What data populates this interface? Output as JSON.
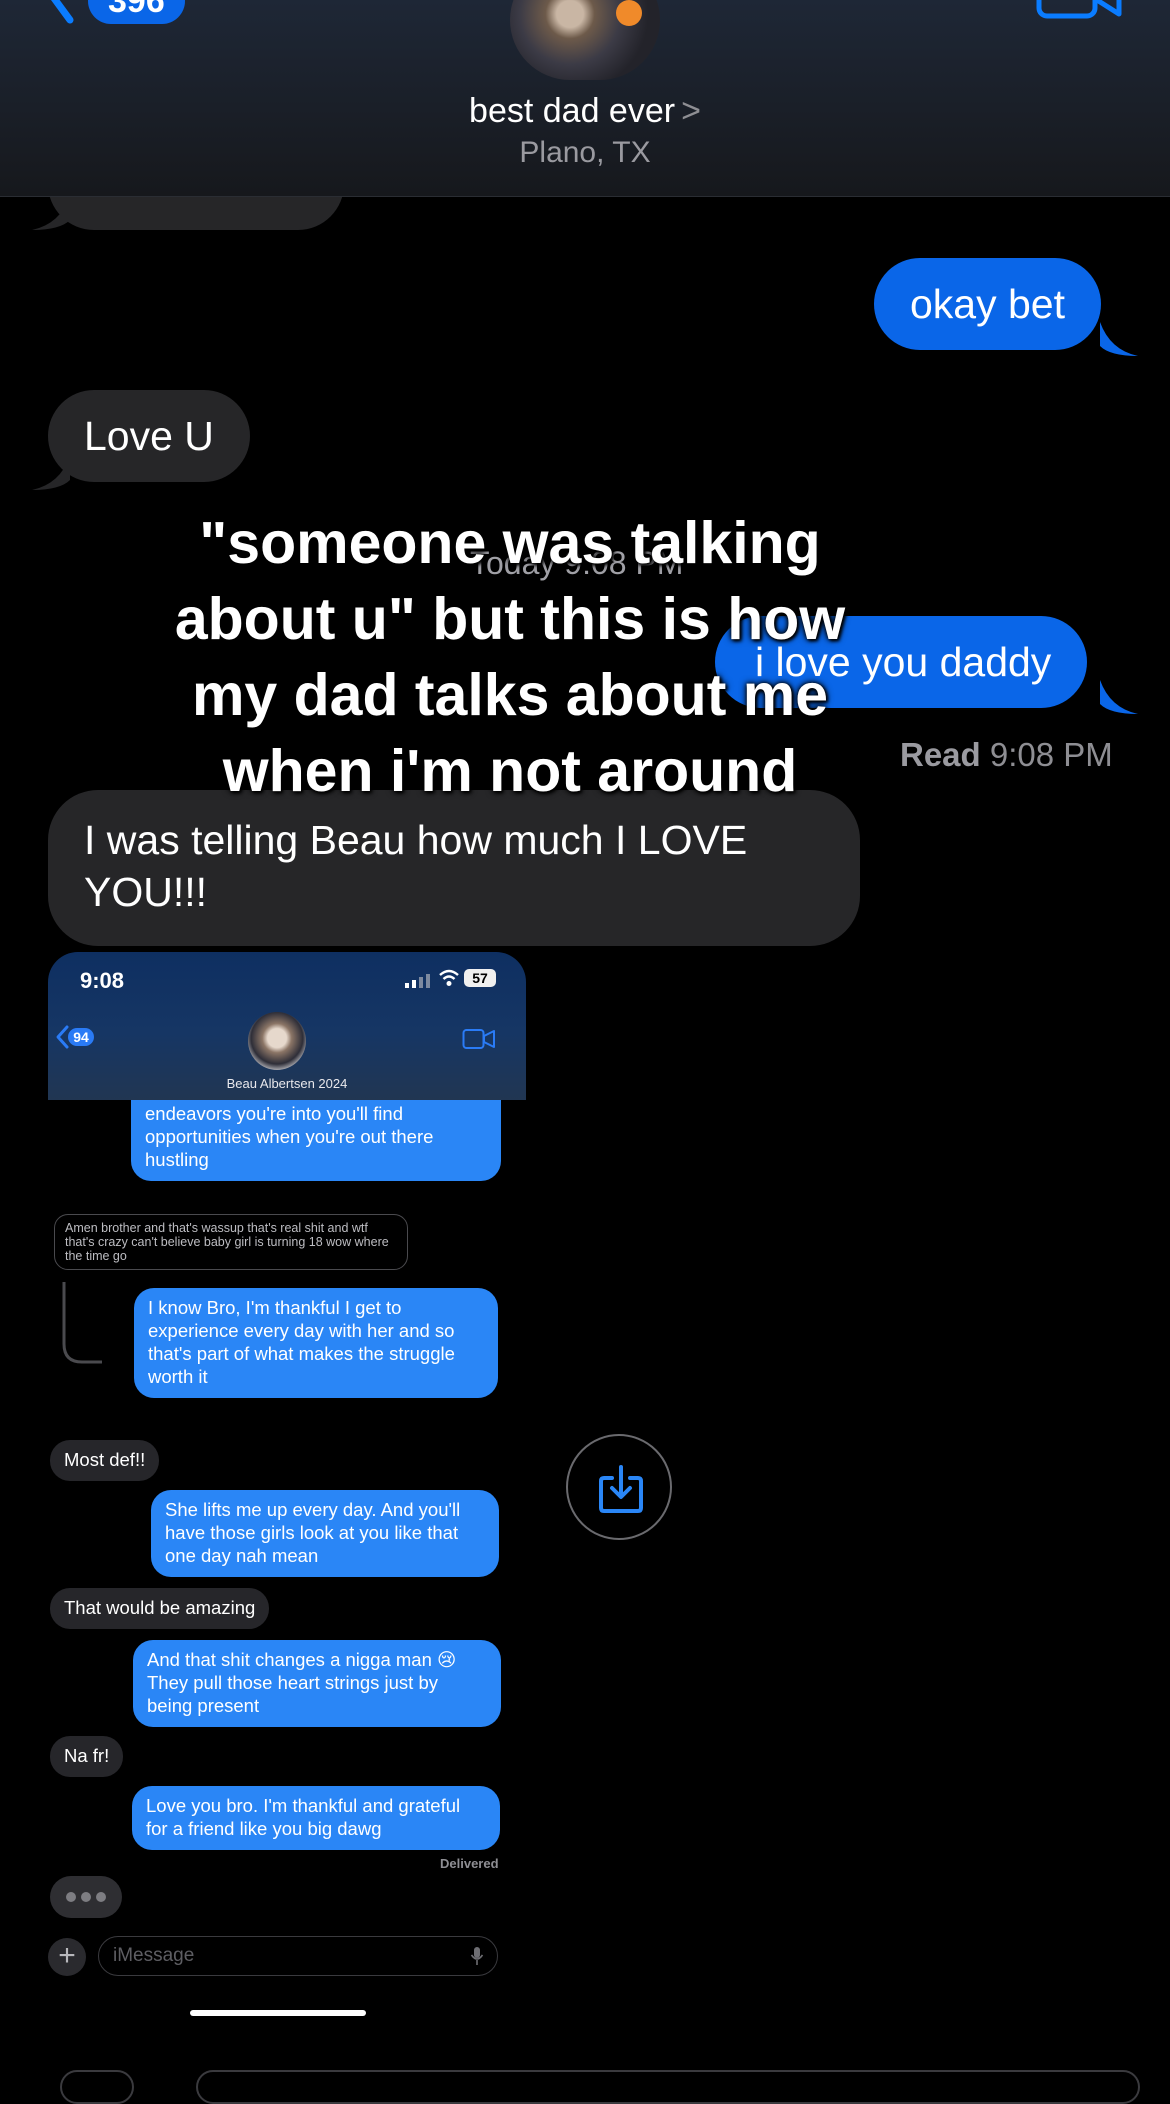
{
  "header": {
    "back_count": "396",
    "contact_name": "best dad ever",
    "name_chevron": ">",
    "location": "Plano, TX"
  },
  "thread": {
    "messages": [
      {
        "from": "me",
        "text": "okay bet"
      },
      {
        "from": "them",
        "text": "Love U"
      },
      {
        "from": "me",
        "text": "i love you daddy"
      },
      {
        "from": "them",
        "text": "I was telling Beau how much I LOVE YOU!!!"
      }
    ],
    "timestamp": "Today 9:08 PM",
    "read_label": "Read",
    "read_time": "9:08 PM"
  },
  "caption": {
    "text": "\"someone was talking about u\" but this is how my dad talks about me when i'm not around"
  },
  "embedded_screenshot": {
    "status_time": "9:08",
    "battery": "57",
    "back_count": "94",
    "contact_name": "Beau Albertsen 2024",
    "messages": [
      {
        "from": "me",
        "text": "endeavors you're into you'll find opportunities when you're out there hustling"
      },
      {
        "from": "quoted",
        "text": "Amen brother and that's wassup that's real shit and wtf that's crazy can't believe baby girl is turning 18 wow where the time go"
      },
      {
        "from": "me",
        "text": "I know Bro, I'm thankful I get to experience every day with her and so that's part of what makes the struggle worth it"
      },
      {
        "from": "them",
        "text": "Most def!!"
      },
      {
        "from": "me",
        "text": "She lifts me up every day. And you'll have those girls look at you like that one day nah mean"
      },
      {
        "from": "them",
        "text": "That would be amazing"
      },
      {
        "from": "me",
        "text": "And that shit changes a nigga man 😢 They pull those heart strings just by being present"
      },
      {
        "from": "them",
        "text": "Na fr!"
      },
      {
        "from": "me",
        "text": "Love you bro. I'm thankful and grateful for a friend like you big dawg"
      }
    ],
    "delivered": "Delivered",
    "input_placeholder": "iMessage",
    "plus_label": "+"
  },
  "colors": {
    "outgoing_bubble": "#0a66e8",
    "incoming_bubble": "#262628",
    "embedded_outgoing": "#2a86f6"
  },
  "icons": [
    "chevron-left-icon",
    "video-camera-icon",
    "save-download-icon",
    "microphone-icon",
    "wifi-icon",
    "signal-icon",
    "battery-icon"
  ]
}
